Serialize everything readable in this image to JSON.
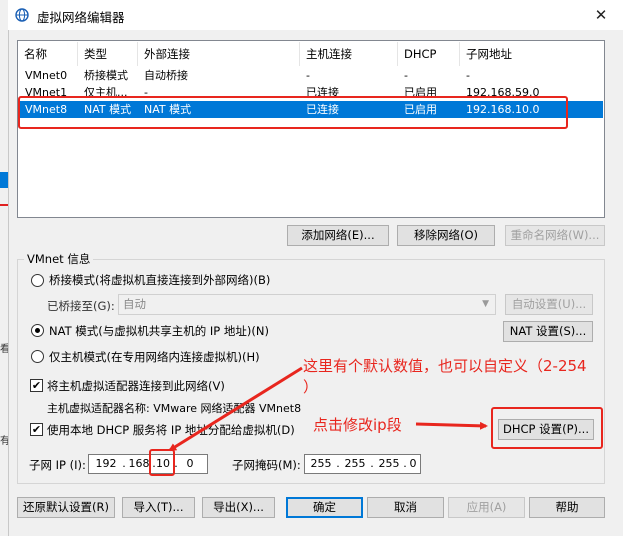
{
  "window": {
    "title": "虚拟网络编辑器",
    "close_glyph": "✕"
  },
  "background_window": {
    "chars": [
      "看",
      "有"
    ]
  },
  "table": {
    "headers": [
      "名称",
      "类型",
      "外部连接",
      "主机连接",
      "DHCP",
      "子网地址"
    ],
    "rows": [
      [
        "VMnet0",
        "桥接模式",
        "自动桥接",
        "-",
        "-",
        "-"
      ],
      [
        "VMnet1",
        "仅主机...",
        "-",
        "已连接",
        "已启用",
        "192.168.59.0"
      ],
      [
        "VMnet8",
        "NAT 模式",
        "NAT 模式",
        "已连接",
        "已启用",
        "192.168.10.0"
      ]
    ],
    "selected_row": 2
  },
  "table_buttons": {
    "add": "添加网络(E)...",
    "remove": "移除网络(O)",
    "rename": "重命名网络(W)..."
  },
  "vmnet_info": {
    "group_label": "VMnet 信息",
    "bridge_radio": "桥接模式(将虚拟机直接连接到外部网络)(B)",
    "bridged_to_label": "已桥接至(G):",
    "bridged_to_value": "自动",
    "auto_settings": "自动设置(U)...",
    "nat_radio": "NAT 模式(与虚拟机共享主机的 IP 地址)(N)",
    "nat_settings": "NAT 设置(S)...",
    "hostonly_radio": "仅主机模式(在专用网络内连接虚拟机)(H)",
    "connect_adapter": "将主机虚拟适配器连接到此网络(V)",
    "adapter_name": "主机虚拟适配器名称: VMware 网络适配器 VMnet8",
    "use_dhcp": "使用本地 DHCP 服务将 IP 地址分配给虚拟机(D)",
    "dhcp_settings": "DHCP 设置(P)...",
    "subnet_ip_label": "子网 IP (I):",
    "subnet_ip": [
      "192",
      "168",
      "10",
      "0"
    ],
    "subnet_mask_label": "子网掩码(M):",
    "subnet_mask": [
      "255",
      "255",
      "255",
      "0"
    ]
  },
  "footer_buttons": {
    "restore": "还原默认设置(R)",
    "import": "导入(T)...",
    "export": "导出(X)...",
    "ok": "确定",
    "cancel": "取消",
    "apply": "应用(A)",
    "help": "帮助"
  },
  "annotations": {
    "note1_line1": "这里有个默认数值，也可以自定义（2-254",
    "note1_line2": "）",
    "note2": "点击修改ip段",
    "color": "#e8261e"
  }
}
